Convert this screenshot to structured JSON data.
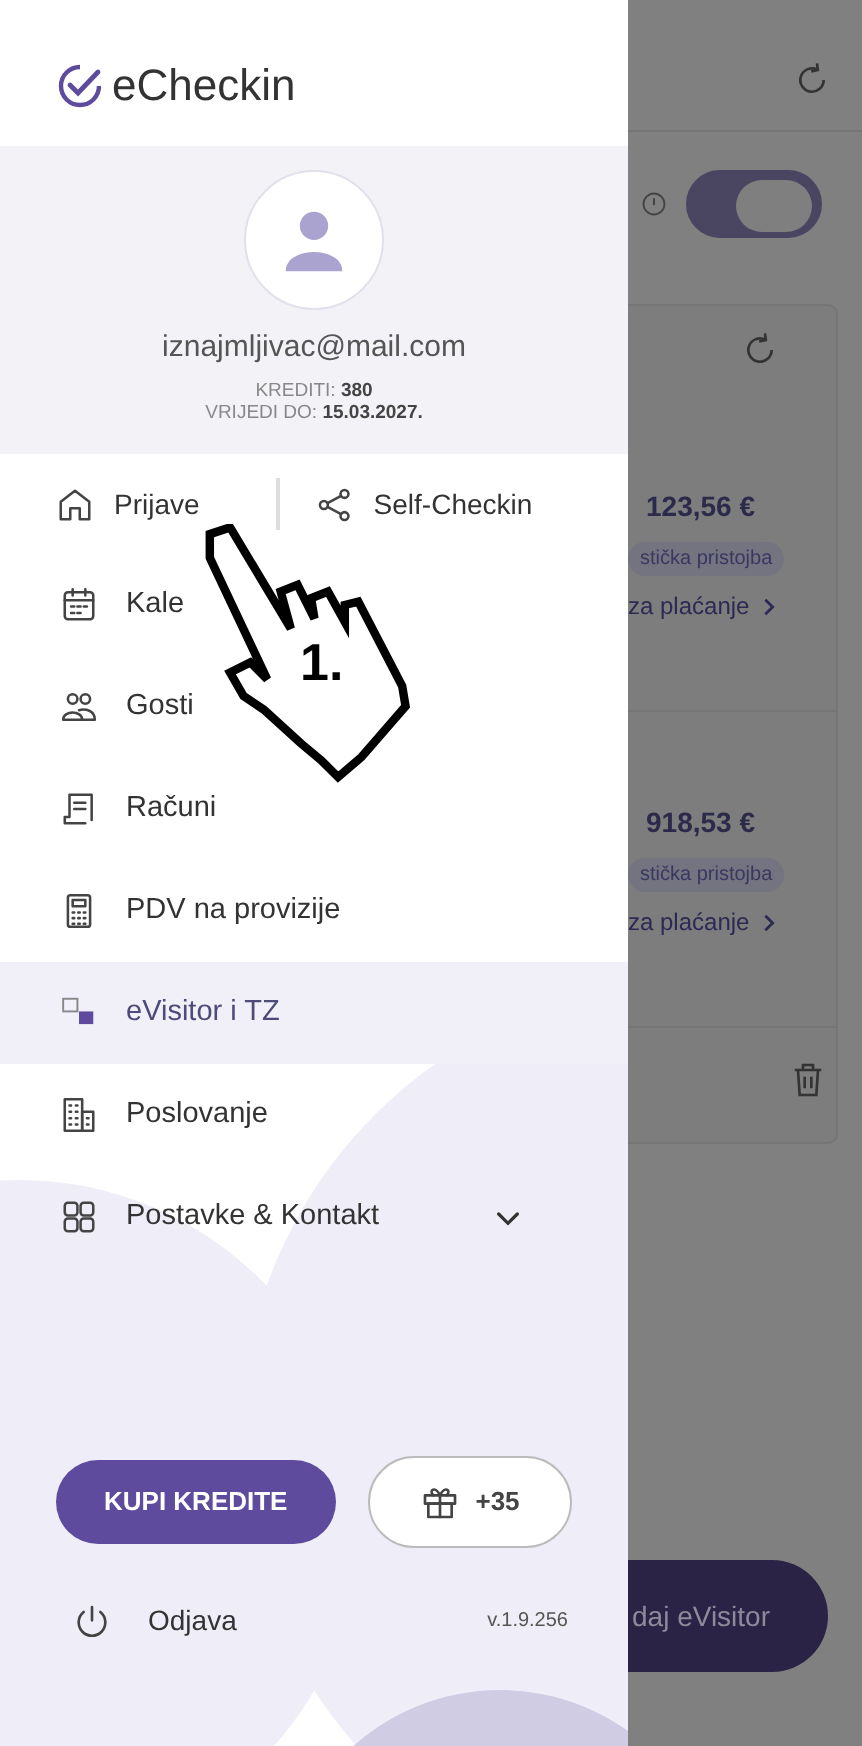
{
  "app": {
    "logo_text": "eCheckin"
  },
  "profile": {
    "email": "iznajmljivac@mail.com",
    "credits_label": "KREDITI:",
    "credits": "380",
    "valid_label": "VRIJEDI DO:",
    "valid_until": "15.03.2027."
  },
  "top_links": [
    {
      "label": "Prijave"
    },
    {
      "label": "Self-Checkin"
    }
  ],
  "menu": [
    {
      "label": "Kale",
      "kind": "link",
      "selected": false
    },
    {
      "label": "Gosti",
      "kind": "link",
      "selected": false
    },
    {
      "label": "Računi",
      "kind": "link",
      "selected": false
    },
    {
      "label": "PDV na provizije",
      "kind": "link",
      "selected": false
    },
    {
      "label": "eVisitor i TZ",
      "kind": "link",
      "selected": true
    },
    {
      "label": "Poslovanje",
      "kind": "link",
      "selected": false
    },
    {
      "label": "Postavke & Kontakt",
      "kind": "group",
      "selected": false,
      "expanded": false
    }
  ],
  "buy_button": "KUPI KREDITE",
  "gift_button": "+35",
  "logout": "Odjava",
  "version": "v.1.9.256",
  "background": {
    "toggle_on": true,
    "entries": [
      {
        "amount": "123,56 €",
        "tag": "stička pristojba",
        "link": "za plaćanje"
      },
      {
        "amount": "918,53 €",
        "tag": "stička pristojba",
        "link": "za plaćanje"
      }
    ],
    "button": "daj eVisitor"
  },
  "annotation": {
    "label": "1."
  }
}
